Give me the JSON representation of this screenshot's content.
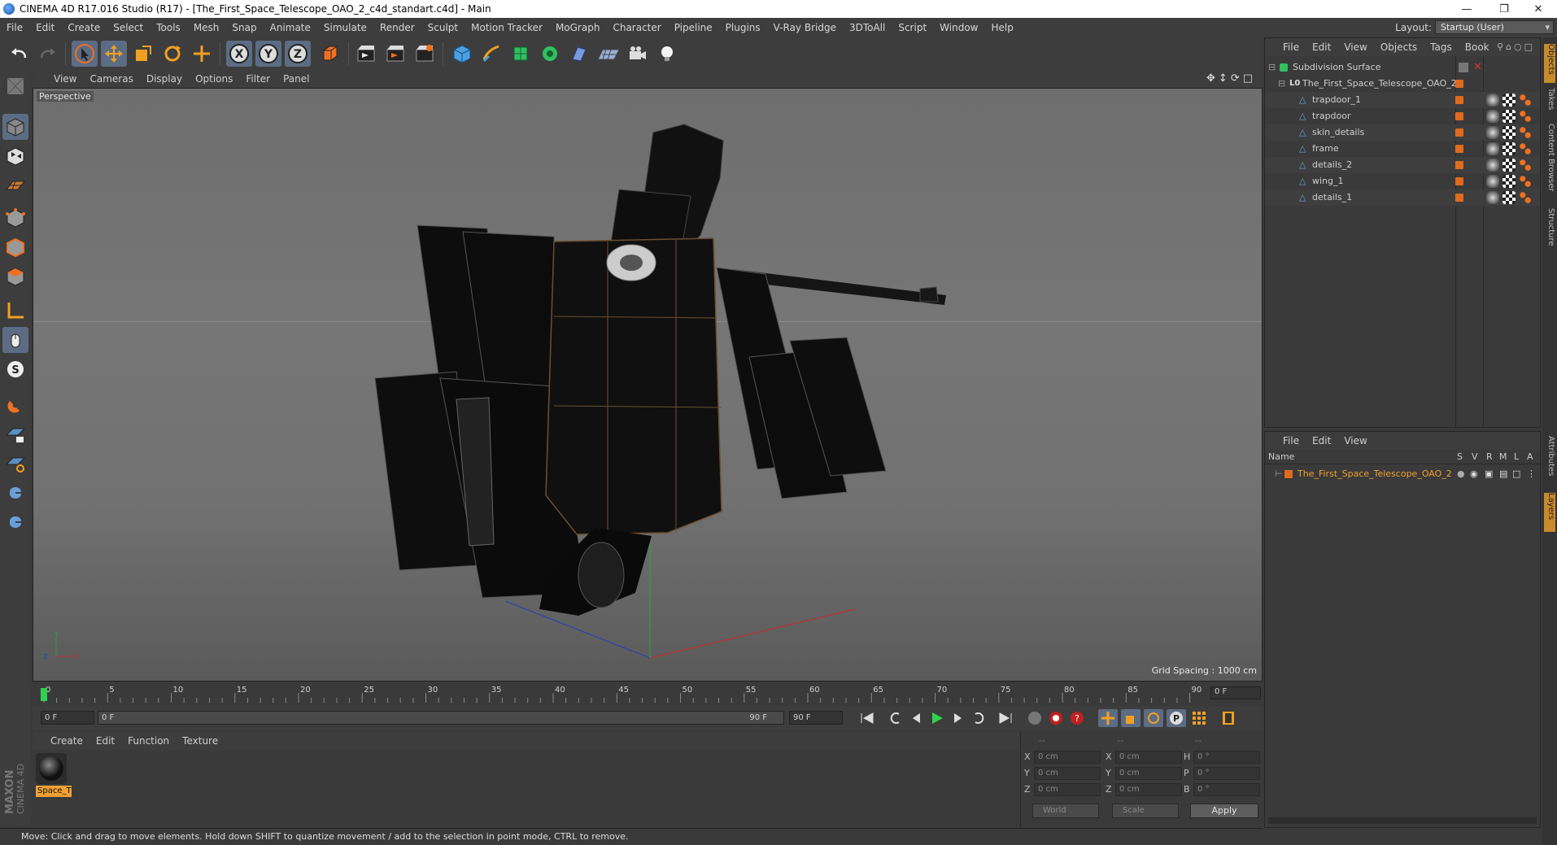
{
  "window": {
    "title": "CINEMA 4D R17.016 Studio (R17) - [The_First_Space_Telescope_OAO_2_c4d_standart.c4d] - Main",
    "controls": [
      "minimize-icon",
      "restore-icon",
      "close-icon"
    ]
  },
  "menubar": {
    "items": [
      "File",
      "Edit",
      "Create",
      "Select",
      "Tools",
      "Mesh",
      "Snap",
      "Animate",
      "Simulate",
      "Render",
      "Sculpt",
      "Motion Tracker",
      "MoGraph",
      "Character",
      "Pipeline",
      "Plugins",
      "V-Ray Bridge",
      "3DToAll",
      "Script",
      "Window",
      "Help"
    ],
    "layout_label": "Layout:",
    "layout_value": "Startup (User)"
  },
  "toolbar": {
    "icons": [
      "undo-icon",
      "redo-icon",
      "select-icon",
      "move-icon",
      "scale-icon",
      "rotate-icon",
      "live-move-icon",
      "x-axis-icon",
      "y-axis-icon",
      "z-axis-icon",
      "coordinate-system-icon",
      "render-view-icon",
      "render-picture-viewer-icon",
      "render-settings-icon",
      "cube-icon",
      "pen-icon",
      "subdivision-icon",
      "cloner-icon",
      "deformer-icon",
      "floor-icon",
      "camera-icon",
      "light-icon"
    ]
  },
  "viewport": {
    "menu": [
      "View",
      "Cameras",
      "Display",
      "Options",
      "Filter",
      "Panel"
    ],
    "label": "Perspective",
    "grid_spacing": "Grid Spacing : 1000 cm"
  },
  "timeline": {
    "ticks": [
      "0",
      "5",
      "10",
      "15",
      "20",
      "25",
      "30",
      "35",
      "40",
      "45",
      "50",
      "55",
      "60",
      "65",
      "70",
      "75",
      "80",
      "85",
      "90"
    ],
    "current_frame": "0 F"
  },
  "playbar": {
    "start": "0 F",
    "range_start": "0 F",
    "range_end": "90 F",
    "end": "90 F"
  },
  "materials": {
    "menu": [
      "Create",
      "Edit",
      "Function",
      "Texture"
    ],
    "items": [
      {
        "label": "Space_T"
      }
    ]
  },
  "coordinates": {
    "header": [
      "--",
      "--",
      "--"
    ],
    "rows": [
      {
        "a": "X",
        "av": "0 cm",
        "b": "X",
        "bv": "0 cm",
        "c": "H",
        "cv": "0 °"
      },
      {
        "a": "Y",
        "av": "0 cm",
        "b": "Y",
        "bv": "0 cm",
        "c": "P",
        "cv": "0 °"
      },
      {
        "a": "Z",
        "av": "0 cm",
        "b": "Z",
        "bv": "0 cm",
        "c": "B",
        "cv": "0 °"
      }
    ],
    "mode": "World",
    "size_mode": "Scale",
    "apply": "Apply"
  },
  "status": "Move: Click and drag to move elements. Hold down SHIFT to quantize movement / add to the selection in point mode, CTRL to remove.",
  "object_manager": {
    "menu": [
      "File",
      "Edit",
      "View",
      "Objects",
      "Tags",
      "Book"
    ],
    "objects": [
      {
        "name": "Subdivision Surface",
        "indent": 0
      },
      {
        "name": "The_First_Space_Telescope_OAO_2",
        "indent": 1
      },
      {
        "name": "trapdoor_1",
        "indent": 2
      },
      {
        "name": "trapdoor",
        "indent": 2
      },
      {
        "name": "skin_details",
        "indent": 2
      },
      {
        "name": "frame",
        "indent": 2
      },
      {
        "name": "details_2",
        "indent": 2
      },
      {
        "name": "wing_1",
        "indent": 2
      },
      {
        "name": "details_1",
        "indent": 2
      }
    ]
  },
  "layer_manager": {
    "menu": [
      "File",
      "Edit",
      "View"
    ],
    "columns": [
      "Name",
      "S",
      "V",
      "R",
      "M",
      "L",
      "A"
    ],
    "layers": [
      {
        "name": "The_First_Space_Telescope_OAO_2",
        "color": "#e06a1e"
      }
    ]
  },
  "right_tabs": [
    "Objects",
    "Takes",
    "Content Browser",
    "Structure",
    "Attributes",
    "Layers"
  ],
  "brand": {
    "maxon": "MAXON",
    "product": "CINEMA 4D"
  }
}
